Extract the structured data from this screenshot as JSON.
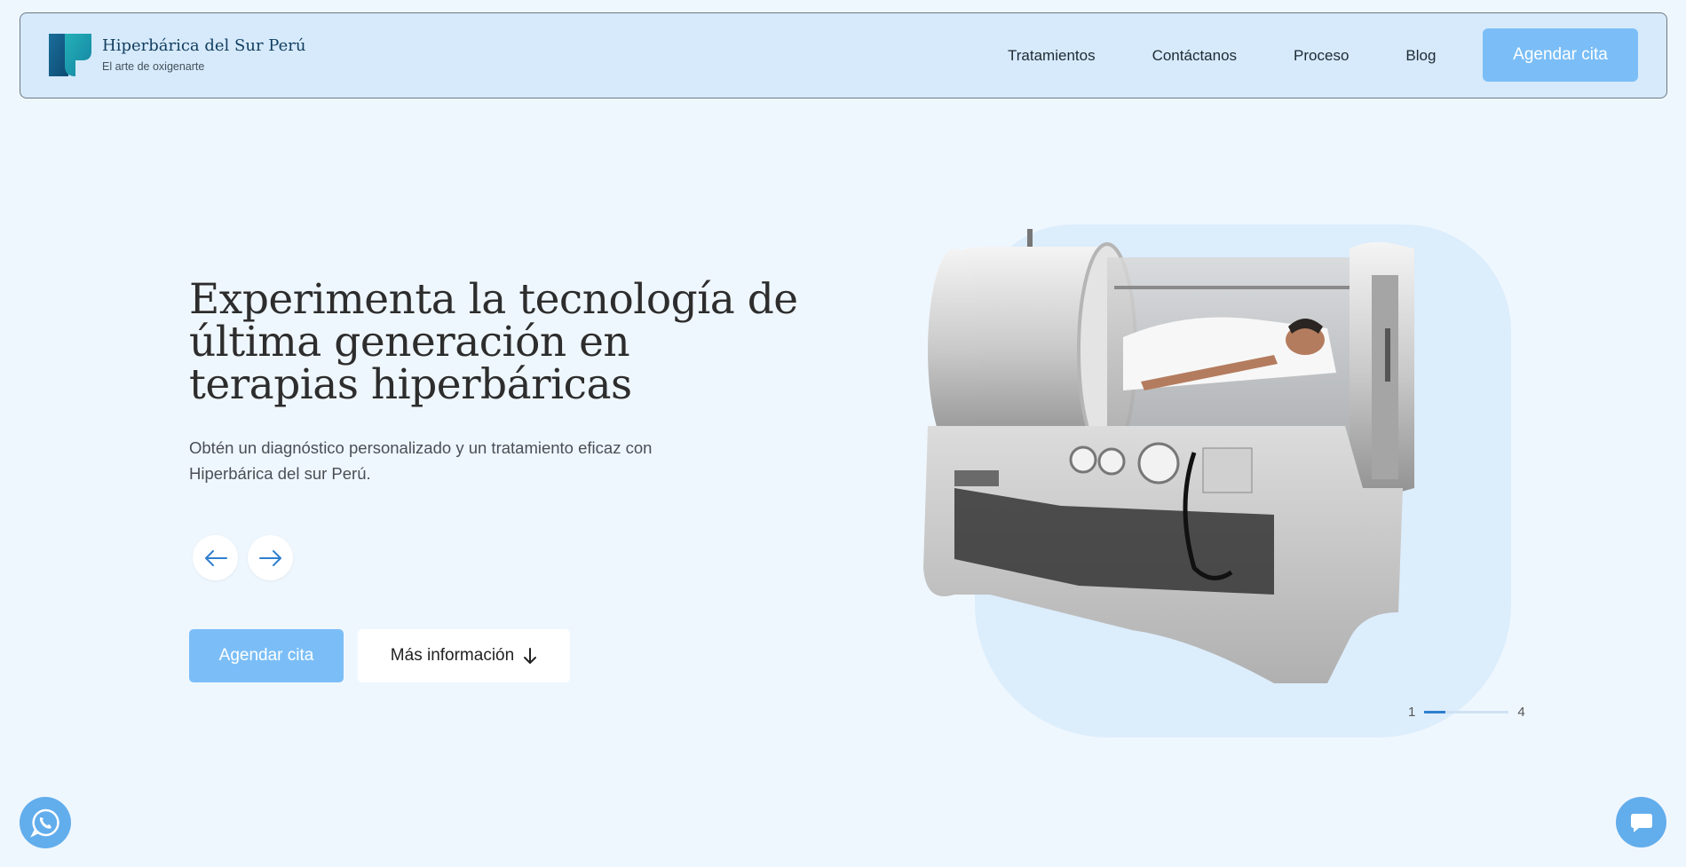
{
  "brand": {
    "name": "Hiperbárica del Sur Perú",
    "tagline": "El arte de oxigenarte"
  },
  "nav": {
    "items": [
      {
        "label": "Tratamientos"
      },
      {
        "label": "Contáctanos"
      },
      {
        "label": "Proceso"
      },
      {
        "label": "Blog"
      }
    ],
    "cta_label": "Agendar cita"
  },
  "hero": {
    "title": "Experimenta la tecnología de última generación en terapias hiperbáricas",
    "subtitle": "Obtén un diagnóstico personalizado y un tratamiento eficaz con Hiperbárica del sur Perú.",
    "primary_cta": "Agendar cita",
    "secondary_cta": "Más información"
  },
  "slider": {
    "current": "1",
    "total": "4",
    "progress_fraction": 0.25
  },
  "colors": {
    "accent": "#7bbef7",
    "background": "#eff7fe",
    "header_bg": "#d6eafc",
    "indicator": "#2f7fcf"
  },
  "icons": {
    "prev": "arrow-left-icon",
    "next": "arrow-right-icon",
    "more": "arrow-down-icon",
    "whatsapp": "whatsapp-icon",
    "chat": "chat-bubble-icon"
  }
}
